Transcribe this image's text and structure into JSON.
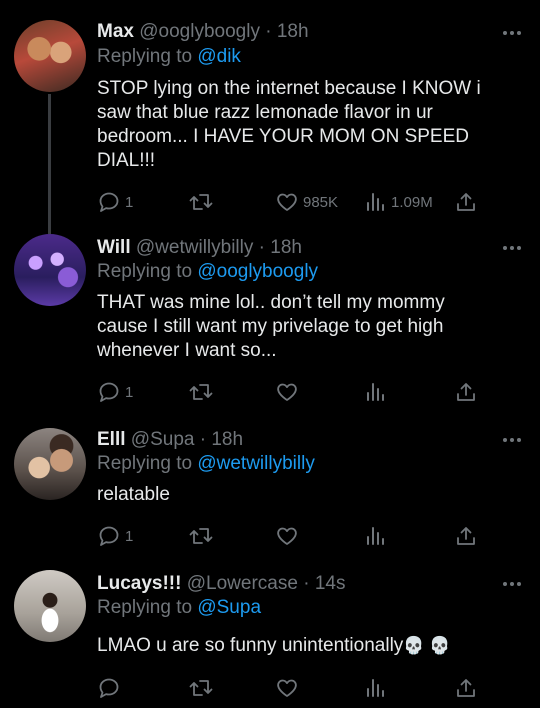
{
  "tweets": [
    {
      "name": "Max",
      "handle": "@ooglyboogly",
      "sep": "·",
      "time": "18h",
      "replying_label": "Replying to ",
      "replying_to": "@dik",
      "lines": [
        "STOP lying on the internet because I KNOW i",
        "saw that blue razz lemonade flavor in ur",
        "bedroom... I HAVE YOUR MOM ON SPEED",
        "DIAL!!!"
      ],
      "replies": "1",
      "retweets": "",
      "likes": "985K",
      "views": "1.09M"
    },
    {
      "name": "Will",
      "handle": "@wetwillybilly",
      "sep": "·",
      "time": "18h",
      "replying_label": "Replying to ",
      "replying_to": "@ooglyboogly",
      "lines": [
        "THAT was mine lol.. don’t tell my mommy",
        "cause I still want my privelage to get high",
        "whenever I want so..."
      ],
      "replies": "1",
      "retweets": "",
      "likes": "",
      "views": ""
    },
    {
      "name": "Elll",
      "handle": "@Supa",
      "sep": "·",
      "time": "18h",
      "replying_label": "Replying to ",
      "replying_to": "@wetwillybilly",
      "lines": [
        "relatable"
      ],
      "replies": "1",
      "retweets": "",
      "likes": "",
      "views": ""
    },
    {
      "name": "Lucays!!!",
      "handle": "@Lowercase",
      "sep": "·",
      "time": "14s",
      "replying_label": "Replying to ",
      "replying_to": "@Supa",
      "lines": [
        "LMAO u are so funny unintentionally"
      ],
      "emoji": "💀 💀",
      "replies": "",
      "retweets": "",
      "likes": "",
      "views": ""
    }
  ],
  "colors": {
    "background": "#000000",
    "text": "#e7e9ea",
    "muted": "#71767b",
    "link": "#1d9bf0",
    "thread_line": "#3a3d41"
  },
  "icons": [
    "reply-icon",
    "retweet-icon",
    "like-icon",
    "views-icon",
    "share-icon",
    "more-icon"
  ]
}
